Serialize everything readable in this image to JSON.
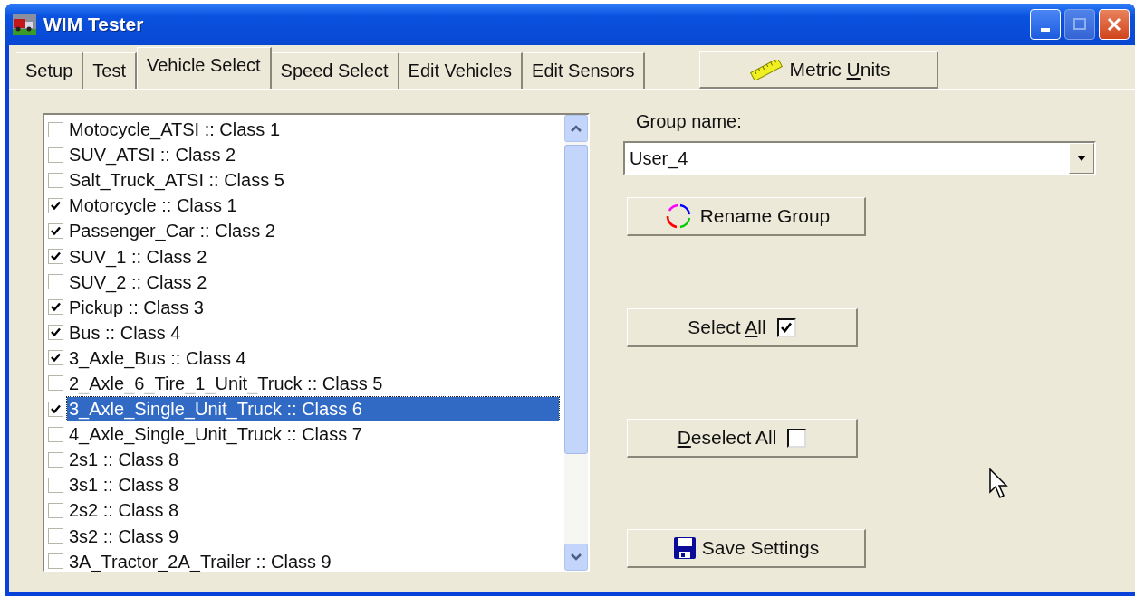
{
  "window": {
    "title": "WIM Tester"
  },
  "tabs": [
    {
      "label": "Setup",
      "selected": false
    },
    {
      "label": "Test",
      "selected": false
    },
    {
      "label": "Vehicle Select",
      "selected": true
    },
    {
      "label": "Speed Select",
      "selected": false
    },
    {
      "label": "Edit Vehicles",
      "selected": false
    },
    {
      "label": "Edit Sensors",
      "selected": false
    }
  ],
  "units_button": {
    "label_before": "Metric ",
    "access_key": "U",
    "label_after": "nits"
  },
  "vehicle_list": [
    {
      "label": "Motocycle_ATSI :: Class 1",
      "checked": false,
      "selected": false
    },
    {
      "label": "SUV_ATSI :: Class 2",
      "checked": false,
      "selected": false
    },
    {
      "label": "Salt_Truck_ATSI :: Class 5",
      "checked": false,
      "selected": false
    },
    {
      "label": "Motorcycle :: Class 1",
      "checked": true,
      "selected": false
    },
    {
      "label": "Passenger_Car :: Class 2",
      "checked": true,
      "selected": false
    },
    {
      "label": "SUV_1 :: Class 2",
      "checked": true,
      "selected": false
    },
    {
      "label": "SUV_2 :: Class 2",
      "checked": false,
      "selected": false
    },
    {
      "label": "Pickup :: Class 3",
      "checked": true,
      "selected": false
    },
    {
      "label": "Bus :: Class 4",
      "checked": true,
      "selected": false
    },
    {
      "label": "3_Axle_Bus :: Class 4",
      "checked": true,
      "selected": false
    },
    {
      "label": "2_Axle_6_Tire_1_Unit_Truck :: Class 5",
      "checked": false,
      "selected": false
    },
    {
      "label": "3_Axle_Single_Unit_Truck :: Class 6",
      "checked": true,
      "selected": true
    },
    {
      "label": "4_Axle_Single_Unit_Truck :: Class 7",
      "checked": false,
      "selected": false
    },
    {
      "label": "2s1 :: Class 8",
      "checked": false,
      "selected": false
    },
    {
      "label": "3s1 :: Class 8",
      "checked": false,
      "selected": false
    },
    {
      "label": "2s2 :: Class 8",
      "checked": false,
      "selected": false
    },
    {
      "label": "3s2 :: Class 9",
      "checked": false,
      "selected": false
    },
    {
      "label": "3A_Tractor_2A_Trailer :: Class 9",
      "checked": false,
      "selected": false
    }
  ],
  "group_name": {
    "label": "Group name:",
    "value": "User_4"
  },
  "buttons": [
    {
      "kind": "rename",
      "label_before": "Rename Group"
    },
    {
      "kind": "select_all",
      "label_before": "Select ",
      "access_key": "A",
      "label_after": "ll",
      "checked": true
    },
    {
      "kind": "deselect_all",
      "access_key": "D",
      "label_after": "eselect All",
      "checked": false
    },
    {
      "kind": "save",
      "label_before": "Save Settings"
    }
  ]
}
